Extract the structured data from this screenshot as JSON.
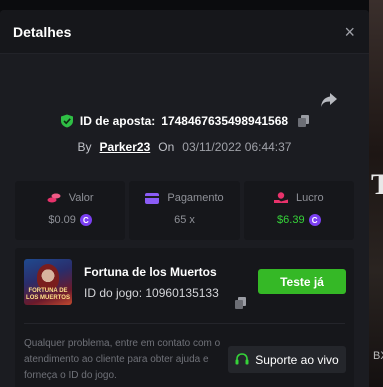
{
  "modal": {
    "title": "Detalhes",
    "close_icon": "×"
  },
  "bet": {
    "id_label": "ID de aposta:",
    "id_value": "1748467635498941568",
    "by_label": "By",
    "user": "Parker23",
    "on_label": "On",
    "date": "03/11/2022 06:44:37"
  },
  "stats": [
    {
      "label": "Valor",
      "value": "$0.09",
      "icon": "coins-icon",
      "color": "#e8326b"
    },
    {
      "label": "Pagamento",
      "value": "65 x",
      "icon": "card-icon",
      "color": "#8b5cf6"
    },
    {
      "label": "Lucro",
      "value": "$6.39",
      "icon": "hand-coin-icon",
      "color": "#e8326b"
    }
  ],
  "game": {
    "name": "Fortuna de los Muertos",
    "id_label": "ID do jogo: 10960135133",
    "thumbnail_text": "FORTUNA DE LOS MUERTOS",
    "try_button": "Teste já"
  },
  "help": {
    "text": "Qualquer problema, entre em contato com o atendimento ao cliente para obter ajuda e forneça o ID do jogo.",
    "support_button": "Suporte ao vivo"
  },
  "backdrop": {
    "letter": "T",
    "partial": "BX"
  },
  "colors": {
    "accent_green": "#35b826",
    "profit_green": "#35d239",
    "coin_purple": "#7b3ff2",
    "panel_bg": "#16171b",
    "modal_bg": "#1b1c21"
  }
}
